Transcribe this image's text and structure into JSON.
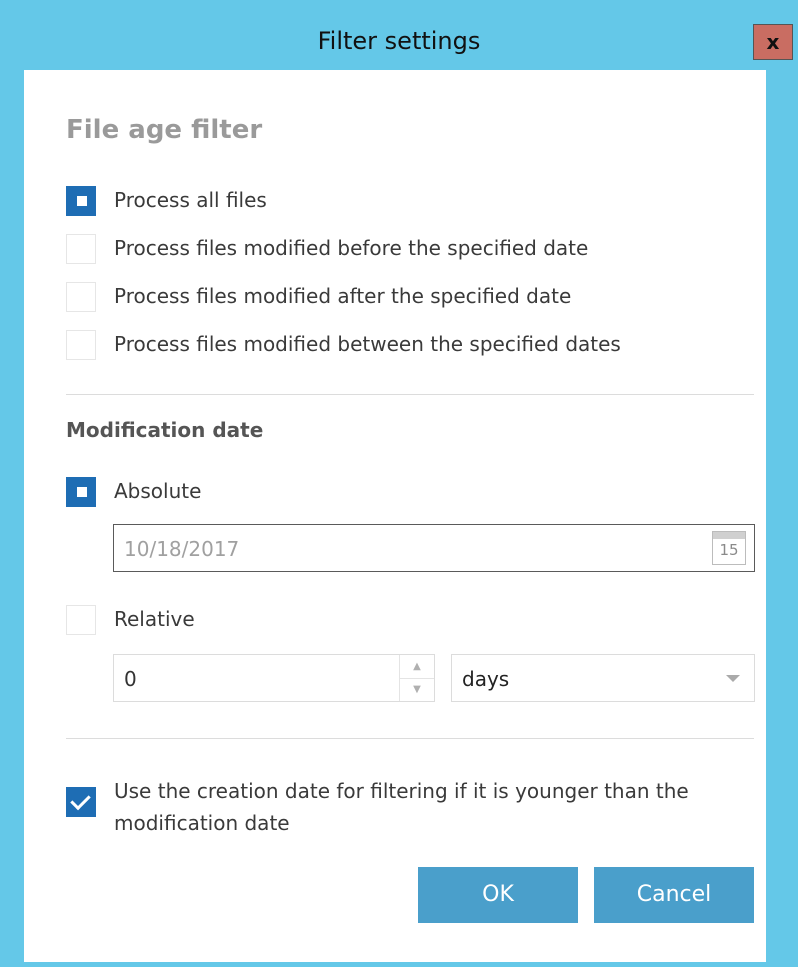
{
  "window": {
    "title": "Filter settings",
    "close_label": "x"
  },
  "file_age_filter": {
    "title": "File age filter",
    "options": [
      {
        "label": "Process all files",
        "selected": true
      },
      {
        "label": "Process files modified before the specified date",
        "selected": false
      },
      {
        "label": "Process files modified after the specified date",
        "selected": false
      },
      {
        "label": "Process files modified between the specified dates",
        "selected": false
      }
    ]
  },
  "modification_date": {
    "title": "Modification date",
    "absolute": {
      "label": "Absolute",
      "selected": true,
      "date_value": "10/18/2017"
    },
    "calendar_day": "15",
    "relative": {
      "label": "Relative",
      "selected": false,
      "amount": "0",
      "unit": "days"
    }
  },
  "creation_date_option": {
    "label": "Use the creation date for filtering if it is younger than the modification date",
    "checked": true
  },
  "buttons": {
    "ok": "OK",
    "cancel": "Cancel"
  },
  "colors": {
    "titlebar": "#64c8e8",
    "close_button": "#c96d62",
    "accent": "#1e6db4",
    "button": "#4a9fcb"
  }
}
